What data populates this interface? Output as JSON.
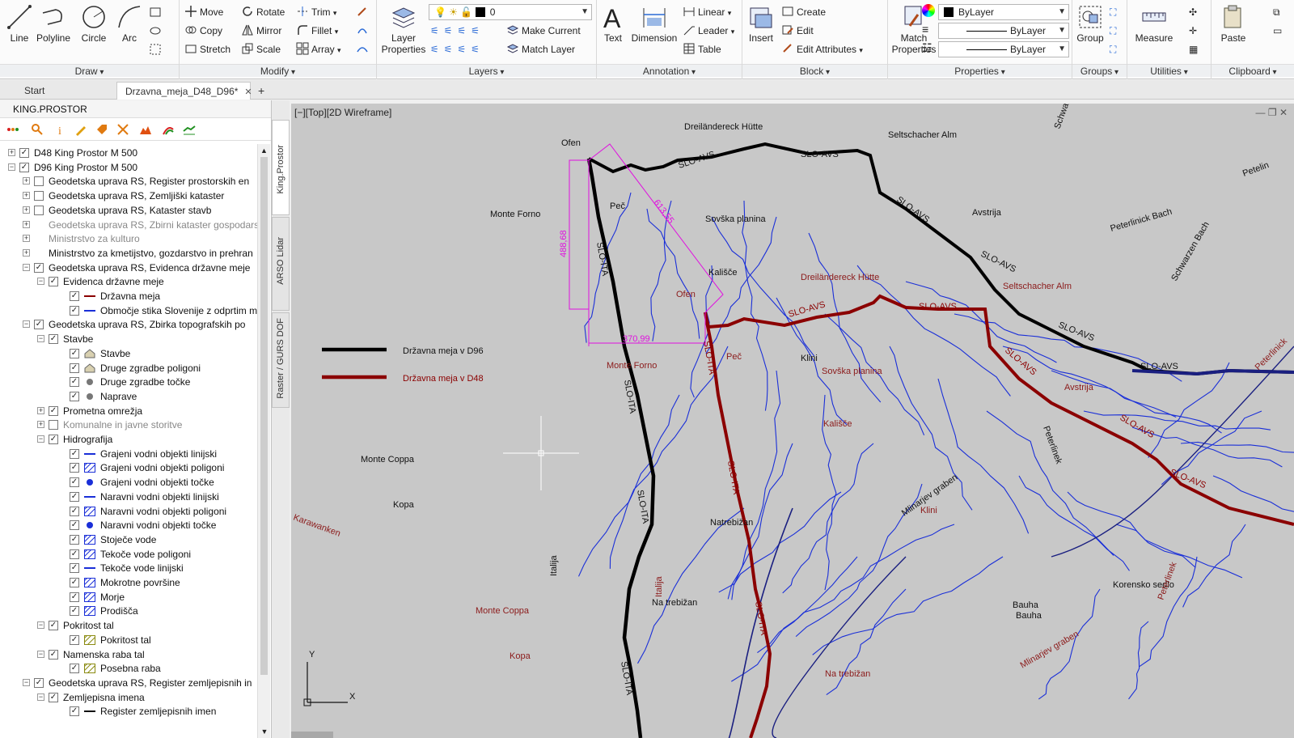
{
  "ribbon": {
    "draw": {
      "title": "Draw",
      "line": "Line",
      "polyline": "Polyline",
      "circle": "Circle",
      "arc": "Arc"
    },
    "modify": {
      "title": "Modify",
      "move": "Move",
      "rotate": "Rotate",
      "trim": "Trim",
      "copy": "Copy",
      "mirror": "Mirror",
      "fillet": "Fillet",
      "stretch": "Stretch",
      "scale": "Scale",
      "array": "Array"
    },
    "layers": {
      "title": "Layers",
      "layer_properties": "Layer Properties",
      "layer_value": "0",
      "make_current": "Make Current",
      "match_layer": "Match Layer"
    },
    "annotation": {
      "title": "Annotation",
      "text": "Text",
      "dimension": "Dimension",
      "linear": "Linear",
      "leader": "Leader",
      "table": "Table"
    },
    "block": {
      "title": "Block",
      "insert": "Insert",
      "create": "Create",
      "edit": "Edit",
      "edit_attributes": "Edit Attributes"
    },
    "properties": {
      "title": "Properties",
      "match_properties": "Match Properties",
      "color": "ByLayer",
      "linetype": "ByLayer",
      "lineweight": "ByLayer"
    },
    "groups": {
      "title": "Groups",
      "group": "Group"
    },
    "utilities": {
      "title": "Utilities",
      "measure": "Measure"
    },
    "clipboard": {
      "title": "Clipboard",
      "paste": "Paste"
    }
  },
  "tabs": [
    {
      "label": "Start"
    },
    {
      "label": "Drzavna_meja_D48_D96*"
    }
  ],
  "leftpane": {
    "title": "KING.PROSTOR",
    "side_tabs": [
      "King.Prostor",
      "ARSO Lidar",
      "Raster / GURS DOF"
    ],
    "tree": [
      {
        "label": "D48 King Prostor M 500",
        "level": 0,
        "exp": "+",
        "cb": "✓"
      },
      {
        "label": "D96 King Prostor M 500",
        "level": 0,
        "exp": "−",
        "cb": "✓"
      },
      {
        "label": "Geodetska uprava RS, Register prostorskih en",
        "level": 1,
        "exp": "+",
        "cb": ""
      },
      {
        "label": "Geodetska uprava RS, Zemljiški kataster",
        "level": 1,
        "exp": "+",
        "cb": ""
      },
      {
        "label": "Geodetska uprava RS, Kataster stavb",
        "level": 1,
        "exp": "+",
        "cb": ""
      },
      {
        "label": "Geodetska uprava RS, Zbirni kataster gospodarsk",
        "level": 1,
        "exp": "+",
        "cb": "none",
        "grey": true
      },
      {
        "label": "Ministrstvo za kulturo",
        "level": 1,
        "exp": "+",
        "cb": "none",
        "grey": true
      },
      {
        "label": "Ministrstvo za kmetijstvo, gozdarstvo in prehran",
        "level": 1,
        "exp": "+",
        "cb": "none"
      },
      {
        "label": "Geodetska uprava RS, Evidenca državne meje",
        "level": 1,
        "exp": "−",
        "cb": "✓"
      },
      {
        "label": "Evidenca državne meje",
        "level": 2,
        "exp": "−",
        "cb": "✓"
      },
      {
        "label": "Državna meja",
        "level": 3,
        "cb": "✓",
        "legend": "line-red"
      },
      {
        "label": "Območje stika Slovenije z odprtim mo",
        "level": 3,
        "cb": "✓",
        "legend": "line-blue"
      },
      {
        "label": "Geodetska uprava RS, Zbirka topografskih po",
        "level": 1,
        "exp": "−",
        "cb": "✓"
      },
      {
        "label": "Stavbe",
        "level": 2,
        "exp": "−",
        "cb": "✓"
      },
      {
        "label": "Stavbe",
        "level": 3,
        "cb": "✓",
        "legend": "house"
      },
      {
        "label": "Druge zgradbe poligoni",
        "level": 3,
        "cb": "✓",
        "legend": "house"
      },
      {
        "label": "Druge zgradbe točke",
        "level": 3,
        "cb": "✓",
        "legend": "dot-grey"
      },
      {
        "label": "Naprave",
        "level": 3,
        "cb": "✓",
        "legend": "dot-grey"
      },
      {
        "label": "Prometna omrežja",
        "level": 2,
        "exp": "+",
        "cb": "✓"
      },
      {
        "label": "Komunalne in javne storitve",
        "level": 2,
        "exp": "+",
        "cb": "",
        "grey": true
      },
      {
        "label": "Hidrografija",
        "level": 2,
        "exp": "−",
        "cb": "✓"
      },
      {
        "label": "Grajeni vodni objekti linijski",
        "level": 3,
        "cb": "✓",
        "legend": "line-blue"
      },
      {
        "label": "Grajeni vodni objekti poligoni",
        "level": 3,
        "cb": "✓",
        "legend": "hatch-blue"
      },
      {
        "label": "Grajeni vodni objekti točke",
        "level": 3,
        "cb": "✓",
        "legend": "dot-blue"
      },
      {
        "label": "Naravni vodni objekti linijski",
        "level": 3,
        "cb": "✓",
        "legend": "line-blue"
      },
      {
        "label": "Naravni vodni objekti poligoni",
        "level": 3,
        "cb": "✓",
        "legend": "hatch-blue"
      },
      {
        "label": "Naravni vodni objekti točke",
        "level": 3,
        "cb": "✓",
        "legend": "dot-blue"
      },
      {
        "label": "Stoječe vode",
        "level": 3,
        "cb": "✓",
        "legend": "hatch-blue"
      },
      {
        "label": "Tekoče vode poligoni",
        "level": 3,
        "cb": "✓",
        "legend": "hatch-blue"
      },
      {
        "label": "Tekoče vode linijski",
        "level": 3,
        "cb": "✓",
        "legend": "line-blue"
      },
      {
        "label": "Mokrotne površine",
        "level": 3,
        "cb": "✓",
        "legend": "hatch-blue"
      },
      {
        "label": "Morje",
        "level": 3,
        "cb": "✓",
        "legend": "hatch-blue"
      },
      {
        "label": "Prodišča",
        "level": 3,
        "cb": "✓",
        "legend": "hatch-blue"
      },
      {
        "label": "Pokritost tal",
        "level": 2,
        "exp": "−",
        "cb": "✓"
      },
      {
        "label": "Pokritost tal",
        "level": 3,
        "cb": "✓",
        "legend": "hatch-olive"
      },
      {
        "label": "Namenska raba tal",
        "level": 2,
        "exp": "−",
        "cb": "✓"
      },
      {
        "label": "Posebna raba",
        "level": 3,
        "cb": "✓",
        "legend": "hatch-olive"
      },
      {
        "label": "Geodetska uprava RS, Register zemljepisnih in",
        "level": 1,
        "exp": "−",
        "cb": "✓"
      },
      {
        "label": "Zemljepisna imena",
        "level": 2,
        "exp": "−",
        "cb": "✓"
      },
      {
        "label": "Register zemljepisnih imen",
        "level": 3,
        "cb": "✓",
        "legend": "line-black"
      }
    ]
  },
  "viewport": {
    "title": "[−][Top][2D Wireframe]",
    "controls": "— ❐ ✕",
    "legend": [
      {
        "label": "Državna meja v D96",
        "color": "#000000"
      },
      {
        "label": "Državna meja v D48",
        "color": "#8b0000"
      }
    ],
    "dimensions": {
      "d1": "488,68",
      "d2": "613,55",
      "d3": "370,99",
      "color": "#e010e0"
    },
    "labels_black": [
      "Ofen",
      "Dreiländereck Hütte",
      "Seltschacher Alm",
      "Schwarze",
      "Petelin",
      "Peč",
      "Sovška planina",
      "Avstrija",
      "Peterlinick Bach",
      "Schwarzen Bach",
      "Monte Forno",
      "Kališče",
      "Klini",
      "Monte Coppa",
      "Kopa",
      "Natrebižan",
      "Italija",
      "Na trebižan",
      "Bauha",
      "Bauha",
      "Korensko sedlo",
      "Peterlinek",
      "Mlinarjev graben"
    ],
    "labels_red": [
      "Dreiländereck Hütte",
      "Seltschacher Alm",
      "Ofen",
      "Peč",
      "Monte Forno",
      "Sovška planina",
      "Kališče",
      "Avstrija",
      "Klini",
      "Karawanken",
      "Italija",
      "Monte Coppa",
      "Kopa",
      "Na trebižan",
      "Mlinarjev graben",
      "Peterlinek",
      "Peterlinick"
    ],
    "border_labels": [
      "SLO-AVS",
      "SLO-ITA"
    ],
    "colors": {
      "background": "#c8c8c8",
      "d96": "#000000",
      "d48": "#8b0000",
      "rivers": "#1a2fd8",
      "dims": "#e010e0"
    }
  }
}
